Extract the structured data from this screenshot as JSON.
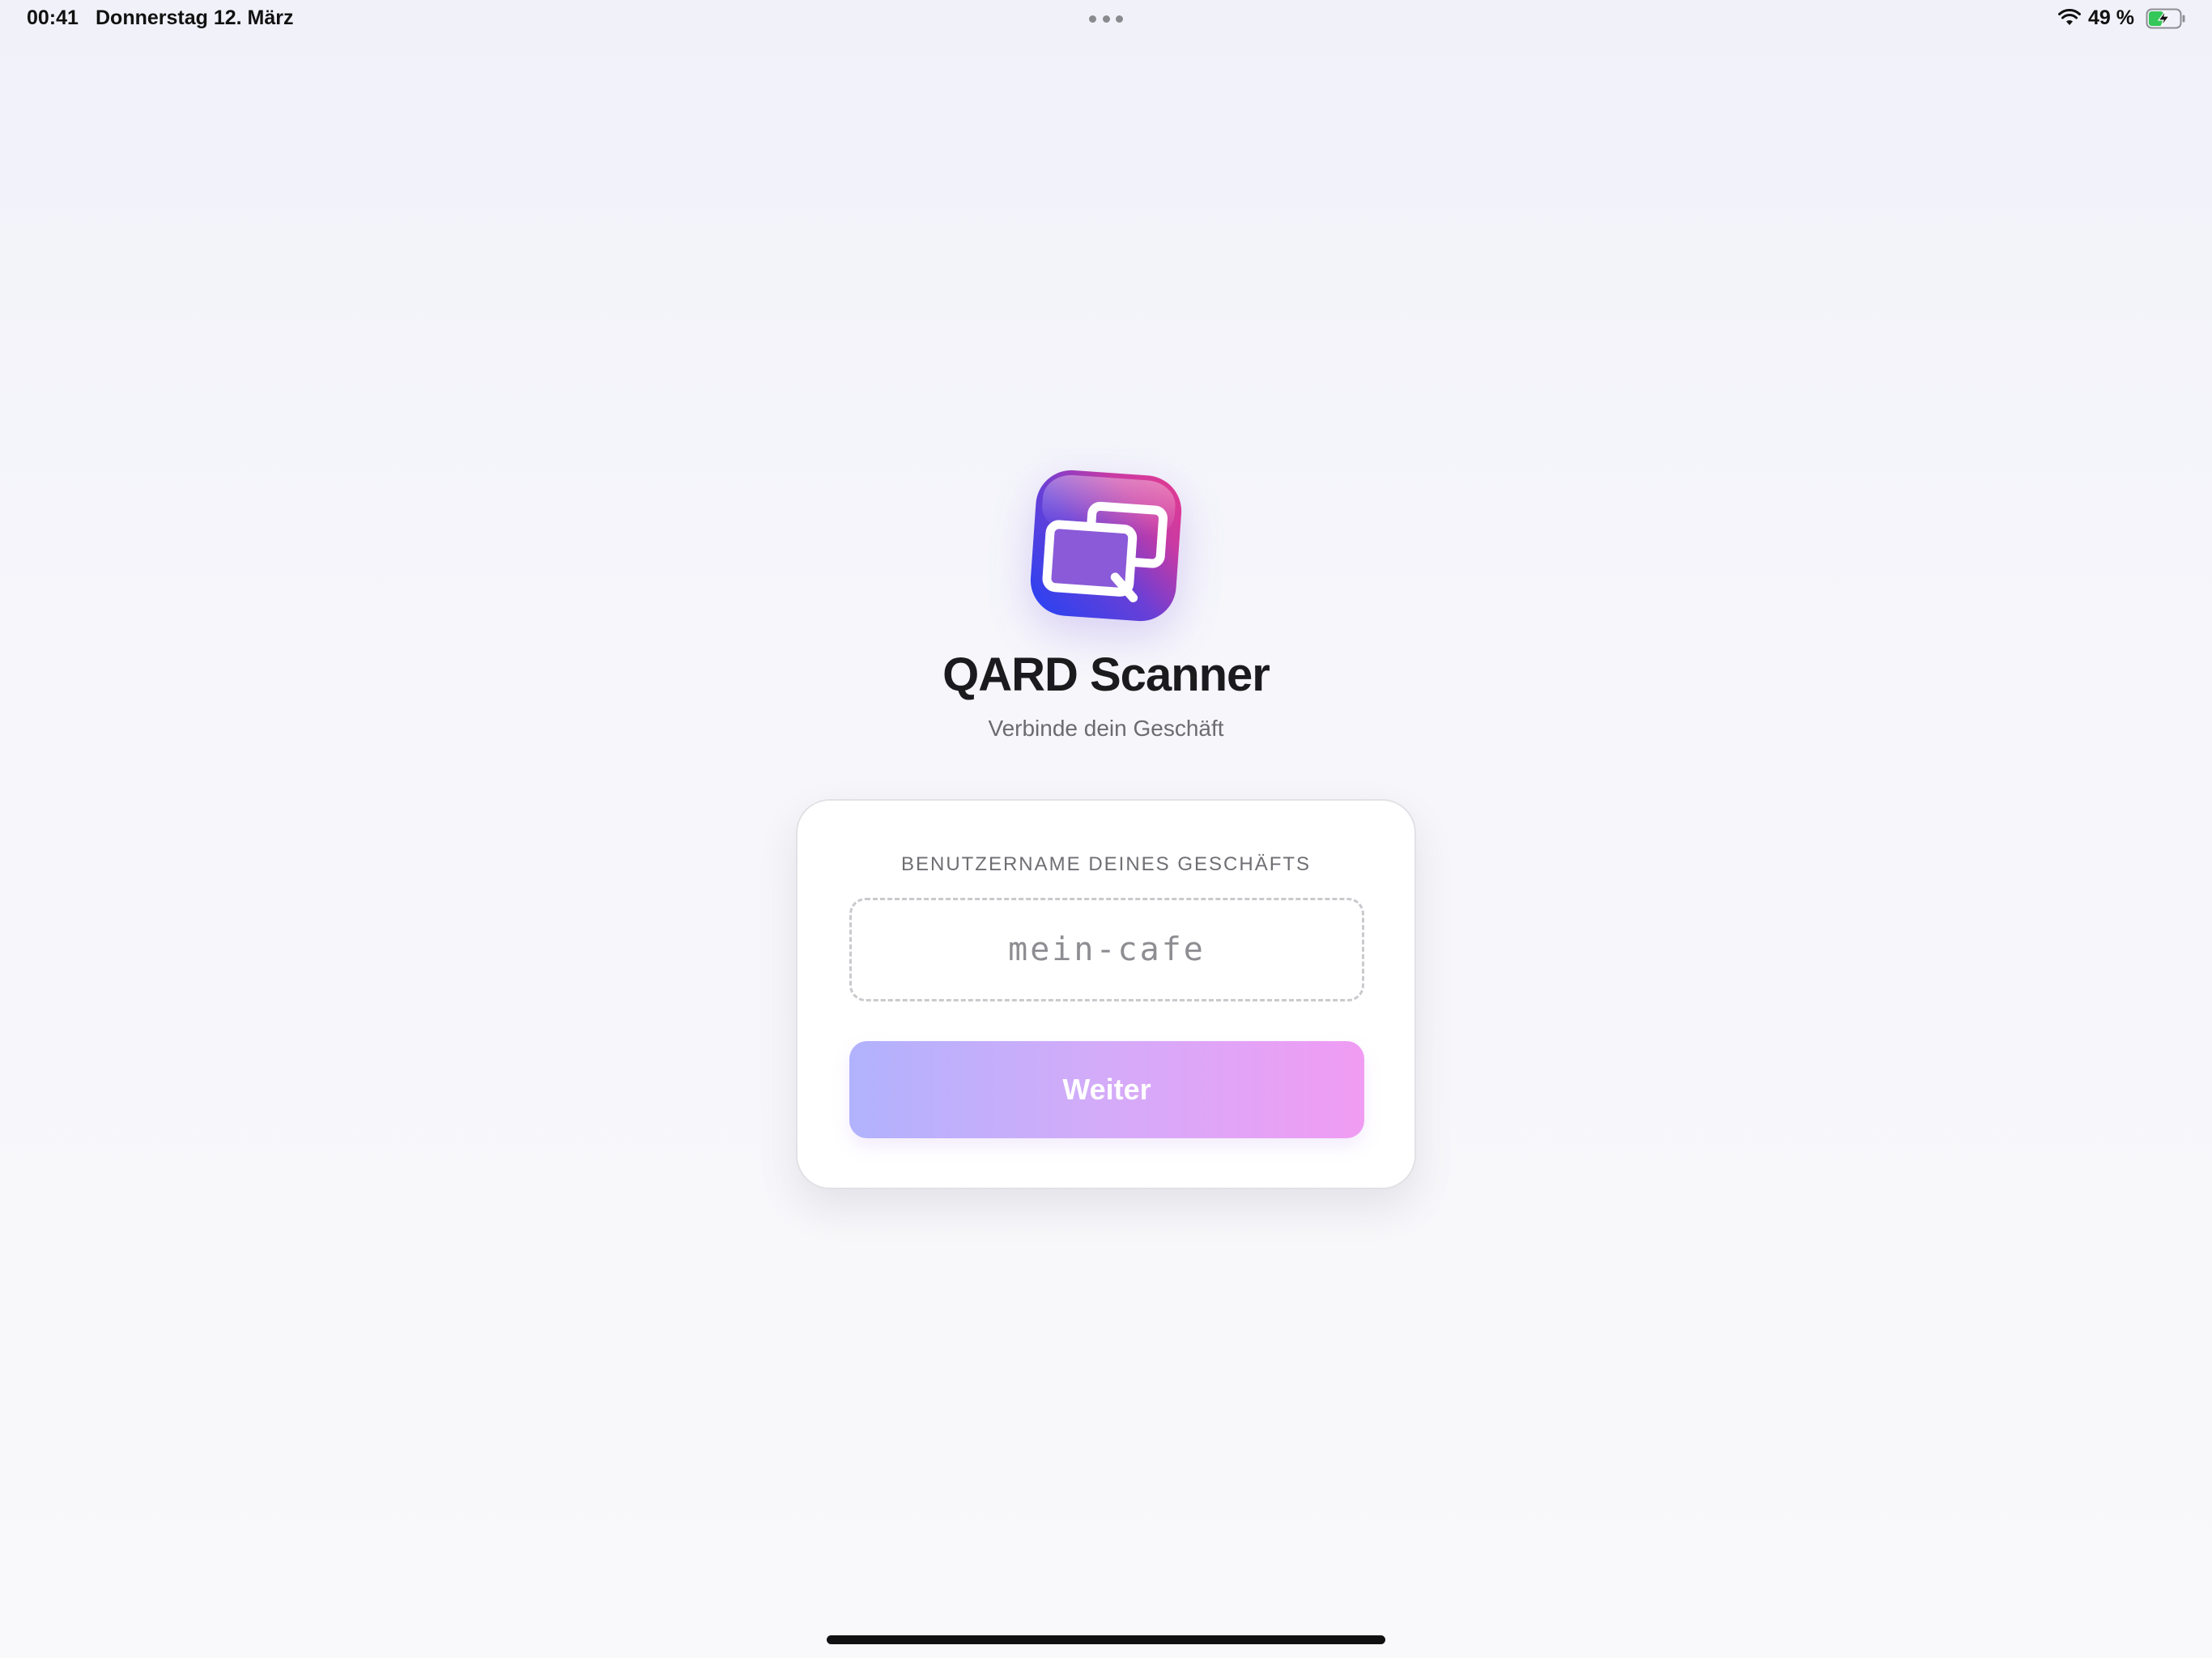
{
  "status_bar": {
    "time": "00:41",
    "date": "Donnerstag 12. März",
    "battery_percent": "49 %",
    "battery_level": 0.49,
    "charging": true,
    "icons": [
      "multitask-dots-icon",
      "wifi-icon",
      "battery-charging-icon"
    ]
  },
  "app": {
    "title": "QARD Scanner",
    "subtitle": "Verbinde dein Geschäft",
    "logo_icon": "qard-logo-icon"
  },
  "login_card": {
    "field_label": "BENUTZERNAME DEINES GESCHÄFTS",
    "username_placeholder": "mein-cafe",
    "username_value": "",
    "continue_label": "Weiter"
  },
  "colors": {
    "background": "#f6f6fb",
    "button_gradient_start": "#b1b2fd",
    "button_gradient_end": "#f09cf3",
    "logo_gradient_blue": "#2542f4",
    "logo_gradient_pink": "#e43a8f"
  }
}
